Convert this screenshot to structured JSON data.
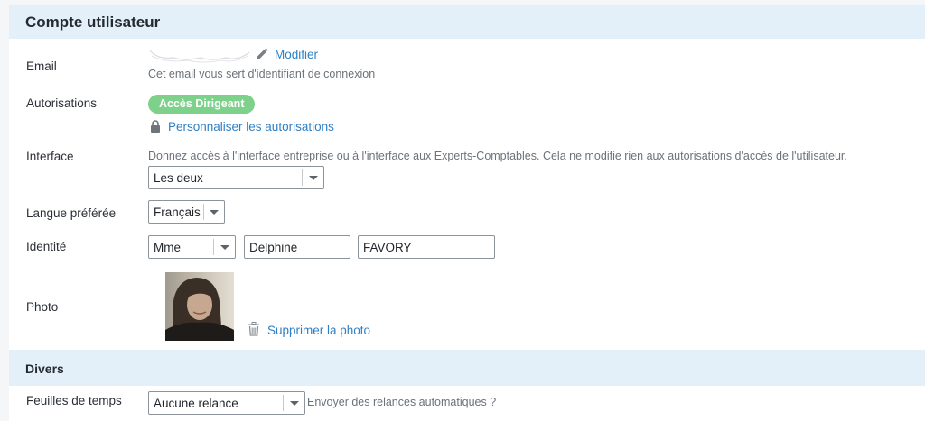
{
  "account": {
    "title": "Compte utilisateur",
    "email": {
      "label": "Email",
      "modify_link": "Modifier",
      "help": "Cet email vous sert d'identifiant de connexion"
    },
    "permissions": {
      "label": "Autorisations",
      "badge": "Accès Dirigeant",
      "badge_color": "#7ed18a",
      "customize_link": "Personnaliser les autorisations"
    },
    "interface": {
      "label": "Interface",
      "help": "Donnez accès à l'interface entreprise ou à l'interface aux Experts-Comptables. Cela ne modifie rien aux autorisations d'accès de l'utilisateur.",
      "selected": "Les deux"
    },
    "language": {
      "label": "Langue préférée",
      "selected": "Français"
    },
    "identity": {
      "label": "Identité",
      "civility": "Mme",
      "first_name": "Delphine",
      "last_name": "FAVORY"
    },
    "photo": {
      "label": "Photo",
      "delete_link": "Supprimer la photo"
    }
  },
  "misc": {
    "title": "Divers",
    "timesheets": {
      "label": "Feuilles de temps",
      "selected": "Aucune relance",
      "help": "Envoyer des relances automatiques ?"
    }
  },
  "colors": {
    "header_bg": "#e3f0fa",
    "link": "#2f7fc4",
    "muted_text": "#6c727a"
  },
  "icons": [
    "pencil-icon",
    "lock-icon",
    "trash-icon",
    "chevron-down-icon"
  ]
}
